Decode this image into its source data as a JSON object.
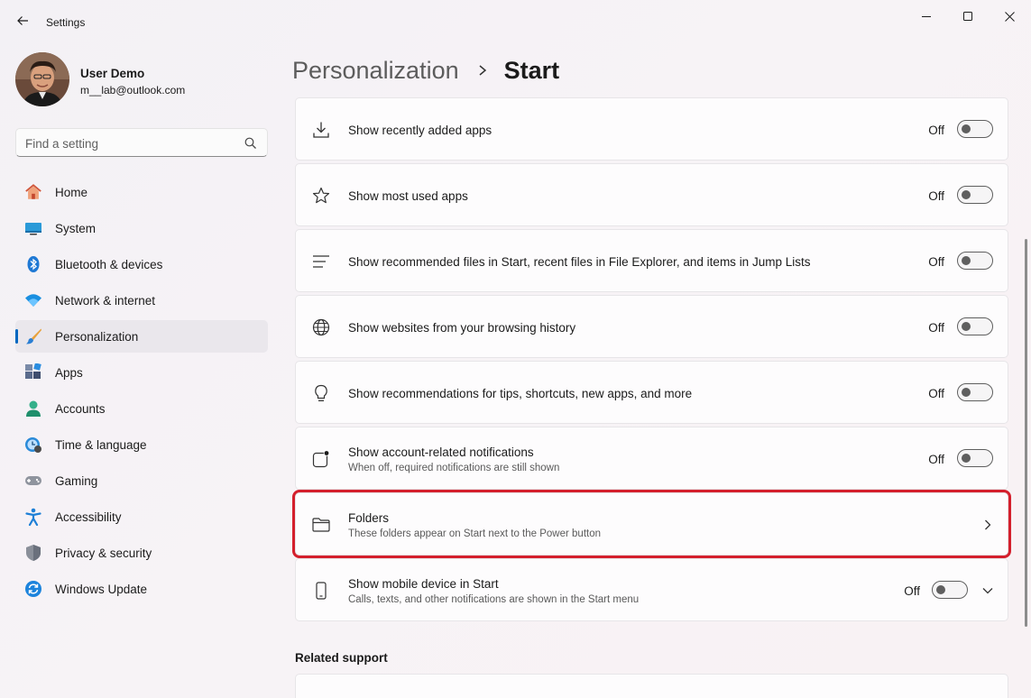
{
  "window": {
    "title": "Settings"
  },
  "profile": {
    "name": "User Demo",
    "email": "m__lab@outlook.com"
  },
  "search": {
    "placeholder": "Find a setting"
  },
  "nav": {
    "items": [
      {
        "label": "Home",
        "icon": "home-icon"
      },
      {
        "label": "System",
        "icon": "system-icon"
      },
      {
        "label": "Bluetooth & devices",
        "icon": "bluetooth-icon"
      },
      {
        "label": "Network & internet",
        "icon": "wifi-icon"
      },
      {
        "label": "Personalization",
        "icon": "brush-icon",
        "active": true
      },
      {
        "label": "Apps",
        "icon": "apps-icon"
      },
      {
        "label": "Accounts",
        "icon": "accounts-icon"
      },
      {
        "label": "Time & language",
        "icon": "clock-globe-icon"
      },
      {
        "label": "Gaming",
        "icon": "gamepad-icon"
      },
      {
        "label": "Accessibility",
        "icon": "accessibility-icon"
      },
      {
        "label": "Privacy & security",
        "icon": "shield-icon"
      },
      {
        "label": "Windows Update",
        "icon": "update-icon"
      }
    ]
  },
  "header": {
    "parent": "Personalization",
    "current": "Start"
  },
  "settings": [
    {
      "title": "Show recently added apps",
      "state": "Off",
      "icon": "download-icon"
    },
    {
      "title": "Show most used apps",
      "state": "Off",
      "icon": "star-icon"
    },
    {
      "title": "Show recommended files in Start, recent files in File Explorer, and items in Jump Lists",
      "state": "Off",
      "icon": "list-icon"
    },
    {
      "title": "Show websites from your browsing history",
      "state": "Off",
      "icon": "globe-icon"
    },
    {
      "title": "Show recommendations for tips, shortcuts, new apps, and more",
      "state": "Off",
      "icon": "lightbulb-icon"
    },
    {
      "title": "Show account-related notifications",
      "desc": "When off, required notifications are still shown",
      "state": "Off",
      "icon": "notification-icon"
    },
    {
      "title": "Folders",
      "desc": "These folders appear on Start next to the Power button",
      "icon": "folder-icon"
    },
    {
      "title": "Show mobile device in Start",
      "desc": "Calls, texts, and other notifications are shown in the Start menu",
      "state": "Off",
      "icon": "phone-icon"
    }
  ],
  "related": {
    "title": "Related support"
  },
  "colors": {
    "accent": "#0067c0",
    "highlight": "#d41f2c"
  }
}
